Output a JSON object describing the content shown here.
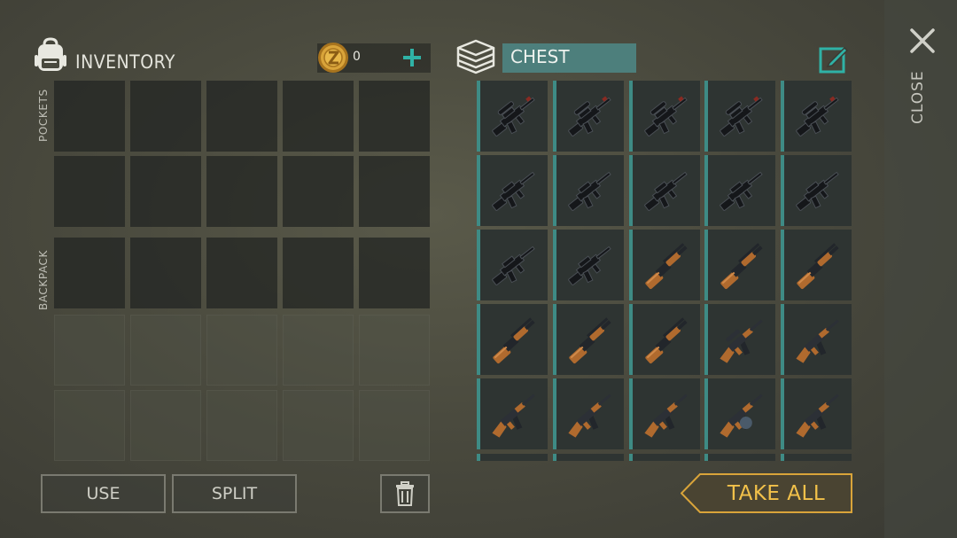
{
  "inventory": {
    "title": "INVENTORY",
    "coins": "0",
    "sections": {
      "pockets": "POCKETS",
      "backpack": "BACKPACK"
    },
    "icons": {
      "header": "backpack-icon",
      "coin": "coin-icon",
      "add": "plus-icon"
    }
  },
  "actions": {
    "use": "USE",
    "split": "SPLIT",
    "trash_icon": "trash-icon"
  },
  "chest": {
    "title": "CHEST",
    "rename_icon": "rename-icon",
    "items": [
      "rifle-scoped",
      "rifle-scoped",
      "rifle-scoped",
      "rifle-scoped",
      "rifle-scoped",
      "rifle",
      "rifle",
      "rifle",
      "rifle",
      "rifle",
      "rifle",
      "rifle",
      "shotgun",
      "shotgun",
      "shotgun",
      "shotgun",
      "shotgun",
      "shotgun",
      "ak-scoped",
      "ak",
      "ak",
      "ak",
      "ak",
      "ak-drum",
      "ak"
    ],
    "take_all": "TAKE ALL"
  },
  "close": {
    "label": "CLOSE",
    "icon": "close-icon"
  },
  "colors": {
    "accent": "#2fb2a6",
    "chest_name_bg": "#4d7f7c",
    "slot_border": "#3e8b85",
    "take_all": "#f2c14a",
    "coin": "#d9a43a"
  }
}
